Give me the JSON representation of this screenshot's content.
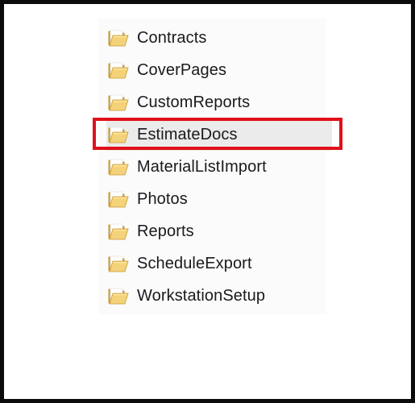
{
  "folders": [
    {
      "name": "Contracts",
      "selected": false
    },
    {
      "name": "CoverPages",
      "selected": false
    },
    {
      "name": "CustomReports",
      "selected": false
    },
    {
      "name": "EstimateDocs",
      "selected": true
    },
    {
      "name": "MaterialListImport",
      "selected": false
    },
    {
      "name": "Photos",
      "selected": false
    },
    {
      "name": "Reports",
      "selected": false
    },
    {
      "name": "ScheduleExport",
      "selected": false
    },
    {
      "name": "WorkstationSetup",
      "selected": false
    }
  ],
  "highlight": {
    "target": "EstimateDocs",
    "color": "#e0101a"
  },
  "icon": "folder-icon",
  "colors": {
    "folder_front": "#f4d27a",
    "folder_back": "#d9a93a",
    "selection": "#ebebeb"
  }
}
